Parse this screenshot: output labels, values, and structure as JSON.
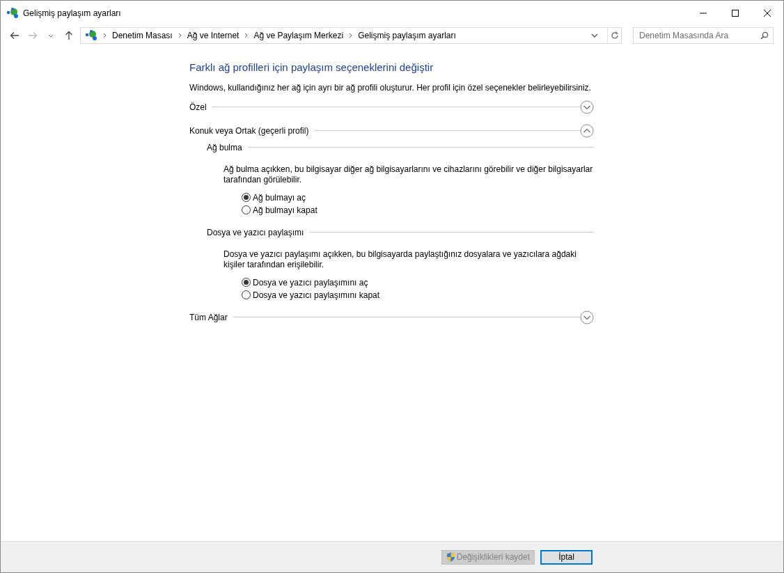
{
  "window": {
    "title": "Gelişmiş paylaşım ayarları"
  },
  "breadcrumb": [
    "Denetim Masası",
    "Ağ ve Internet",
    "Ağ ve Paylaşım Merkezi",
    "Gelişmiş paylaşım ayarları"
  ],
  "search": {
    "placeholder": "Denetim Masasında Ara"
  },
  "heading": "Farklı ağ profilleri için paylaşım seçeneklerini değiştir",
  "intro": "Windows, kullandığınız her ağ için ayrı bir ağ profili oluşturur. Her profil için özel seçenekler belirleyebilirsiniz.",
  "profiles": [
    {
      "label": "Özel",
      "expanded": false
    },
    {
      "label": "Konuk veya Ortak (geçerli profil)",
      "expanded": true,
      "sections": [
        {
          "title": "Ağ bulma",
          "description": "Ağ bulma açıkken, bu bilgisayar diğer ağ bilgisayarlarını ve cihazlarını görebilir ve diğer bilgisayarlar tarafından görülebilir.",
          "options": [
            {
              "label": "Ağ bulmayı aç",
              "selected": true
            },
            {
              "label": "Ağ bulmayı kapat",
              "selected": false
            }
          ]
        },
        {
          "title": "Dosya ve yazıcı paylaşımı",
          "description": "Dosya ve yazıcı paylaşımı açıkken, bu bilgisayarda paylaştığınız dosyalara ve yazıcılara ağdaki kişiler tarafından erişilebilir.",
          "options": [
            {
              "label": "Dosya ve yazıcı paylaşımını aç",
              "selected": true
            },
            {
              "label": "Dosya ve yazıcı paylaşımını kapat",
              "selected": false
            }
          ]
        }
      ]
    },
    {
      "label": "Tüm Ağlar",
      "expanded": false
    }
  ],
  "buttons": [
    {
      "label": "Değişiklikleri kaydet",
      "disabled": true,
      "shield": true
    },
    {
      "label": "İptal",
      "disabled": false,
      "shield": false
    }
  ]
}
